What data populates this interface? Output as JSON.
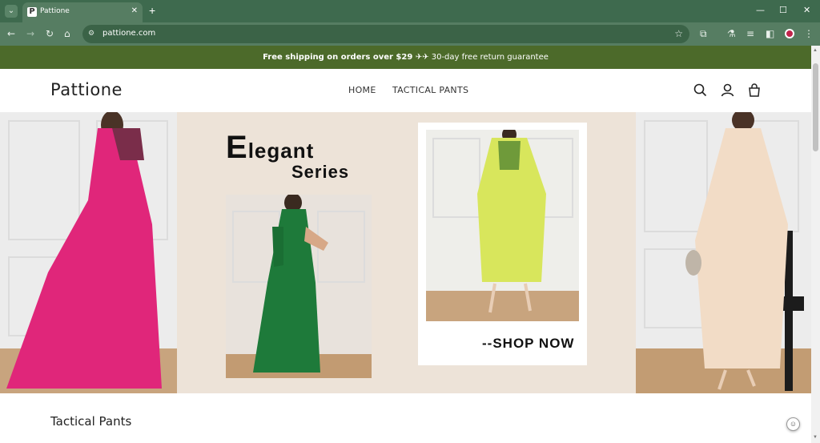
{
  "browser": {
    "tab_title": "Pattione",
    "favicon_letter": "P",
    "url": "pattione.com",
    "icons": [
      "tab-search-icon",
      "close-icon",
      "plus-icon",
      "minimize-icon",
      "maximize-icon",
      "window-close-icon",
      "back-icon",
      "forward-icon",
      "reload-icon",
      "home-icon",
      "site-info-icon",
      "star-icon",
      "extensions-icon",
      "labs-icon",
      "cast-icon",
      "sidebar-icon",
      "profile-icon",
      "kebab-menu-icon"
    ]
  },
  "announcement": {
    "bold": "Free shipping on orders over $29 ✈✈",
    "rest": " 30-day free return guarantee"
  },
  "header": {
    "logo": "Pattione",
    "menu": [
      "HOME",
      "TACTICAL PANTS"
    ]
  },
  "hero": {
    "headline_cap": "E",
    "headline_rest": "legant",
    "headline_line2": "Series",
    "cta": "--SHOP NOW",
    "colors": {
      "pink_dress": "#e0267a",
      "green_dress": "#1e7a3a",
      "yellow_dress": "#d8e65c",
      "cream_dress": "#f2dcc6",
      "banner_bg": "#ede3d8"
    }
  },
  "section": {
    "title": "Tactical Pants"
  },
  "colors": {
    "announcement_bg": "#4c6a2a",
    "chrome_bg": "#456f54"
  }
}
